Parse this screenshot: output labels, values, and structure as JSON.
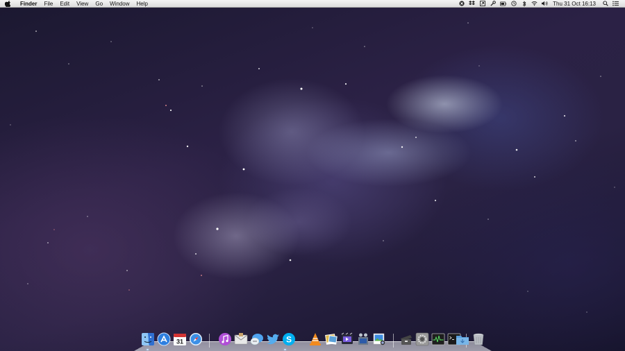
{
  "menubar": {
    "app_name": "Finder",
    "menus": [
      "File",
      "Edit",
      "View",
      "Go",
      "Window",
      "Help"
    ],
    "status_icons": [
      "close-circle-icon",
      "dropbox-icon",
      "share-icon",
      "tools-icon",
      "battery-icon",
      "time-machine-icon",
      "bluetooth-icon",
      "wifi-icon",
      "volume-icon"
    ],
    "clock": "Thu 31 Oct  16:13",
    "right_icons": [
      "spotlight-icon",
      "notification-list-icon"
    ]
  },
  "dock": {
    "calendar_day": "31",
    "apps": [
      {
        "name": "finder-icon",
        "color": "#3c8ee8"
      },
      {
        "name": "app-store-icon",
        "color": "#2e7fe0"
      },
      {
        "name": "calendar-icon",
        "color": "#d33333"
      },
      {
        "name": "safari-icon",
        "color": "#3b8fe6"
      },
      {
        "name": "itunes-icon",
        "color": "#b04fd6"
      },
      {
        "name": "mail-icon",
        "color": "#c8c8c8"
      },
      {
        "name": "messages-icon",
        "color": "#4fa3f0"
      },
      {
        "name": "twitter-icon",
        "color": "#55acee"
      },
      {
        "name": "skype-icon",
        "color": "#00aff0"
      },
      {
        "name": "vlc-icon",
        "color": "#f28a1d"
      },
      {
        "name": "photo-app-icon",
        "color": "#e0b84a"
      },
      {
        "name": "imovie-icon",
        "color": "#7a5de0"
      },
      {
        "name": "film-icon",
        "color": "#6d7a8a"
      },
      {
        "name": "preview-icon",
        "color": "#3d8ce0"
      },
      {
        "name": "archive-icon",
        "color": "#444444"
      },
      {
        "name": "system-preferences-icon",
        "color": "#8a8a8a"
      },
      {
        "name": "activity-monitor-icon",
        "color": "#1e1e1e"
      },
      {
        "name": "terminal-icon",
        "color": "#1a1a1a"
      },
      {
        "name": "downloads-folder-icon",
        "color": "#79b6e8"
      },
      {
        "name": "trash-icon",
        "color": "#b8bcc2"
      }
    ]
  }
}
